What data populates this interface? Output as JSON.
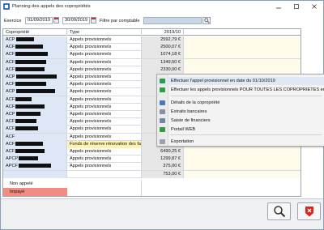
{
  "window": {
    "title": "Planning des appels des copropriétés"
  },
  "filters": {
    "exercice_label": "Exercice",
    "date_start": "01/09/2019",
    "date_end": "30/09/2019",
    "comptable_label": "Filtre par comptable",
    "comptable_value": ""
  },
  "table": {
    "headers": [
      "Copropriété",
      "Type",
      "2019/10",
      ""
    ],
    "rows": [
      {
        "name": "ACP",
        "redact": 22,
        "type": "Appels provisionnels",
        "amount": "2592,79 €"
      },
      {
        "name": "ACF",
        "redact": 34,
        "type": "Appels provisionnels",
        "amount": "2500,07 €"
      },
      {
        "name": "ACF",
        "redact": 40,
        "type": "Appels provisionnels",
        "amount": "1074,18 €"
      },
      {
        "name": "ACF",
        "redact": 38,
        "type": "Appels provisionnels",
        "amount": "1349,50 €"
      },
      {
        "name": "ACF",
        "redact": 36,
        "type": "Appels provisionnels",
        "amount": "2330,00 €"
      },
      {
        "name": "ACP",
        "redact": 50,
        "type": "Appels provisionnels",
        "amount": ""
      },
      {
        "name": "ACF",
        "redact": 38,
        "type": "Appels provisionnels",
        "amount": ""
      },
      {
        "name": "ACP",
        "redact": 48,
        "type": "Appels provisionnels",
        "amount": ""
      },
      {
        "name": "ACF",
        "redact": 20,
        "type": "Appels provisionnels",
        "amount": ""
      },
      {
        "name": "ACF",
        "redact": 36,
        "type": "Appels provisionnels",
        "amount": ""
      },
      {
        "name": "ACP",
        "redact": 30,
        "type": "Appels provisionnels",
        "amount": ""
      },
      {
        "name": "ACF",
        "redact": 26,
        "type": "Appels provisionnels",
        "amount": ""
      },
      {
        "name": "ACF",
        "redact": 28,
        "type": "Appels provisionnels",
        "amount": ""
      },
      {
        "name": "ACF",
        "redact": 0,
        "type": "Appels provisionnels",
        "amount": ""
      },
      {
        "name": "ACF",
        "redact": 34,
        "type": "Fonds de réserve rénovation des facades",
        "amount": "",
        "highlight": true
      },
      {
        "name": "ACF",
        "redact": 36,
        "type": "Appels provisionnels",
        "amount": "6490,25 €"
      },
      {
        "name": "APCP",
        "redact": 24,
        "type": "Appels provisionnels",
        "amount": "1299,87 €"
      },
      {
        "name": "APCF",
        "redact": 40,
        "type": "Appels provisionnels",
        "amount": "375,00 €"
      },
      {
        "name": "",
        "redact": 0,
        "type": "",
        "amount": "753,00 €"
      }
    ],
    "legend": [
      {
        "label": "Non appelé",
        "color": "#ffffff"
      },
      {
        "label": "Impayé",
        "color": "#f28b82"
      }
    ]
  },
  "context_menu": {
    "items": [
      {
        "label": "Effectuer l'appel provisionnel en date du 01/10/2019",
        "icon": "add-green-icon",
        "color": "#2e9b46"
      },
      {
        "label": "Effectuer les appels provisionnels POUR TOUTES LES COPROPRIETES en date d",
        "icon": "add-multi-icon",
        "color": "#2e9b46"
      },
      {
        "label": "Détails de la copropriété",
        "icon": "details-icon",
        "color": "#4a78b6"
      },
      {
        "label": "Extraits bancaires",
        "icon": "bank-icon",
        "color": "#8a8fa3"
      },
      {
        "label": "Saisie de financiers",
        "icon": "finance-icon",
        "color": "#6f86a8"
      },
      {
        "label": "Portail WEB",
        "icon": "web-icon",
        "color": "#2e9b46"
      },
      {
        "label": "Exportation",
        "icon": "export-icon",
        "color": "#9aa3ad"
      }
    ]
  },
  "buttons": {
    "search": "search-icon",
    "close": "exit-icon"
  }
}
